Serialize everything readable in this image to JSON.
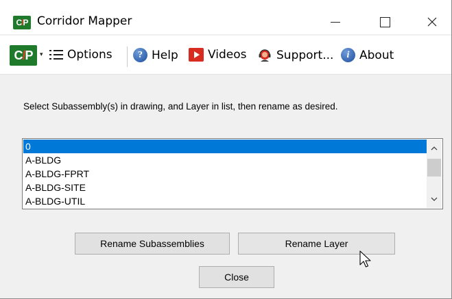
{
  "window": {
    "title": "Corridor Mapper",
    "logo_text_left": "C",
    "logo_text_slash": "/",
    "logo_text_right": "P"
  },
  "toolbar": {
    "logo_caret": "▾",
    "options_label": "Options",
    "help_label": "Help",
    "videos_label": "Videos",
    "support_label": "Support...",
    "about_label": "About"
  },
  "main": {
    "instruction": "Select Subassembly(s) in drawing, and Layer in list, then rename as desired.",
    "layers": [
      "0",
      "A-BLDG",
      "A-BLDG-FPRT",
      "A-BLDG-SITE",
      "A-BLDG-UTIL"
    ],
    "selected_layer": "0"
  },
  "buttons": {
    "rename_subassemblies": "Rename Subassemblies",
    "rename_layer": "Rename Layer",
    "close": "Close"
  },
  "colors": {
    "brand_green": "#1f7a2c",
    "brand_red": "#e23a2a",
    "selection_blue": "#0078d7"
  },
  "icons": {
    "logo": "cp-logo-icon",
    "options": "list-icon",
    "help": "help-icon",
    "videos": "video-play-icon",
    "support": "support-agent-icon",
    "about": "info-icon",
    "cursor": "mouse-pointer-icon"
  }
}
